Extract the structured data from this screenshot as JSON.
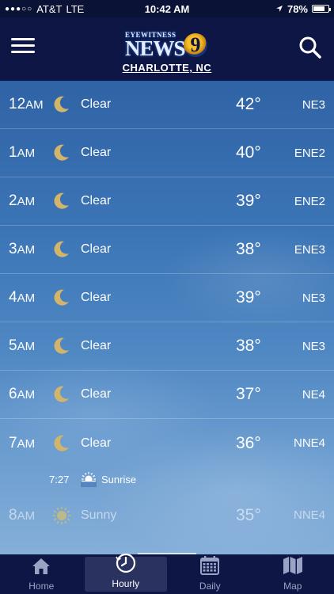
{
  "status_bar": {
    "signal": "●●●○○",
    "carrier": "AT&T",
    "network": "LTE",
    "time": "10:42 AM",
    "battery": "78%",
    "battery_level": 0.78
  },
  "header": {
    "logo_top": "Eyewitness",
    "logo_main": "NEWS",
    "logo_number": "9",
    "city": "CHARLOTTE, NC"
  },
  "hours": [
    {
      "hour": "12",
      "ampm": "AM",
      "icon": "moon-icon",
      "condition": "Clear",
      "temp": "42°",
      "wind": "NE3"
    },
    {
      "hour": "1",
      "ampm": "AM",
      "icon": "moon-icon",
      "condition": "Clear",
      "temp": "40°",
      "wind": "ENE2"
    },
    {
      "hour": "2",
      "ampm": "AM",
      "icon": "moon-icon",
      "condition": "Clear",
      "temp": "39°",
      "wind": "ENE2"
    },
    {
      "hour": "3",
      "ampm": "AM",
      "icon": "moon-icon",
      "condition": "Clear",
      "temp": "38°",
      "wind": "ENE3"
    },
    {
      "hour": "4",
      "ampm": "AM",
      "icon": "moon-icon",
      "condition": "Clear",
      "temp": "39°",
      "wind": "NE3"
    },
    {
      "hour": "5",
      "ampm": "AM",
      "icon": "moon-icon",
      "condition": "Clear",
      "temp": "38°",
      "wind": "NE3"
    },
    {
      "hour": "6",
      "ampm": "AM",
      "icon": "moon-icon",
      "condition": "Clear",
      "temp": "37°",
      "wind": "NE4"
    },
    {
      "hour": "7",
      "ampm": "AM",
      "icon": "moon-icon",
      "condition": "Clear",
      "temp": "36°",
      "wind": "NNE4"
    },
    {
      "hour": "8",
      "ampm": "AM",
      "icon": "sun-icon",
      "condition": "Sunny",
      "temp": "35°",
      "wind": "NNE4"
    }
  ],
  "sunrise": {
    "time": "7:27",
    "label": "Sunrise"
  },
  "tabs": [
    {
      "label": "Home",
      "icon": "house-icon",
      "active": false
    },
    {
      "label": "Hourly",
      "icon": "clock-icon",
      "active": true
    },
    {
      "label": "Daily",
      "icon": "calendar-icon",
      "active": false
    },
    {
      "label": "Map",
      "icon": "map-icon",
      "active": false
    }
  ],
  "colors": {
    "header_bg": "#0d1645",
    "moon": "#d2b46a",
    "sun": "#f0c94a",
    "tab_active": "#ffffff",
    "tab_inactive": "#9aa3c4"
  }
}
